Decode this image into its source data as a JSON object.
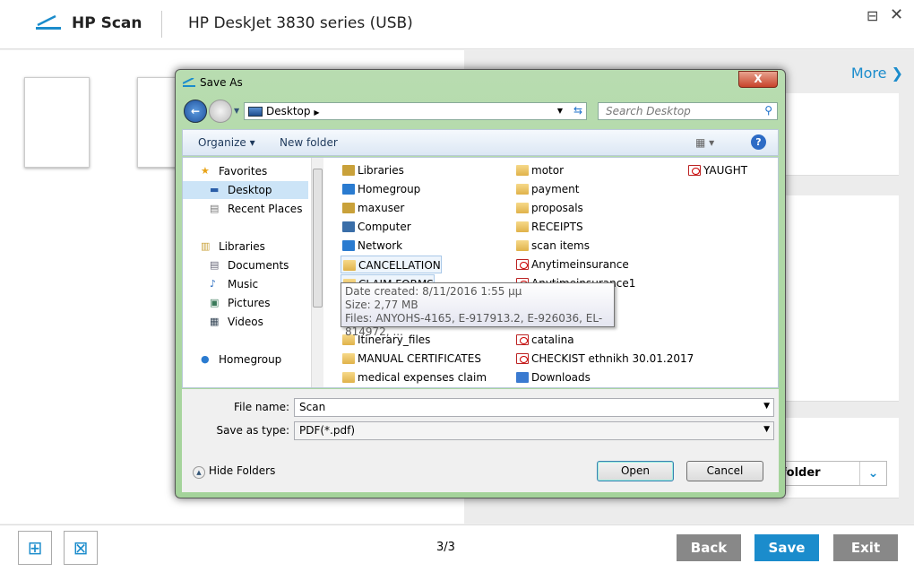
{
  "app": {
    "name": "HP Scan",
    "device": "HP DeskJet 3830 series (USB)",
    "minimize": "⊟",
    "close": "✕"
  },
  "right": {
    "more": "More",
    "destination": "folder",
    "colors": {
      "accent": "#1b8ccc"
    }
  },
  "footer": {
    "page": "3/3",
    "back": "Back",
    "save": "Save",
    "exit": "Exit",
    "add_page_icon": "add-page-icon",
    "delete_page_icon": "delete-page-icon"
  },
  "dialog": {
    "title": "Save As",
    "close": "X",
    "address": "Desktop",
    "search_placeholder": "Search Desktop",
    "toolbar": {
      "organize": "Organize ▾",
      "new_folder": "New folder"
    },
    "nav": [
      {
        "label": "Favorites",
        "head": true
      },
      {
        "label": "Desktop",
        "selected": true
      },
      {
        "label": "Recent Places"
      },
      {
        "label": "Libraries",
        "head": true
      },
      {
        "label": "Documents"
      },
      {
        "label": "Music"
      },
      {
        "label": "Pictures"
      },
      {
        "label": "Videos"
      },
      {
        "label": "Homegroup",
        "head": true
      }
    ],
    "files_col1": [
      "Libraries",
      "Homegroup",
      "maxuser",
      "Computer",
      "Network",
      "CANCELLATION",
      "CLAIM FORMS",
      "",
      "",
      "Itinerary_files",
      "MANUAL CERTIFICATES",
      "medical expenses claim"
    ],
    "files_col2": [
      "motor",
      "payment",
      "proposals",
      "RECEIPTS",
      "scan items",
      "Anytimeinsurance",
      "Anytimeinsurance1",
      "",
      "h",
      "catalina",
      "CHECKIST ethnikh 30.01.2017",
      "Downloads"
    ],
    "files_col3": [
      "YAUGHT"
    ],
    "tooltip": {
      "date": "Date created: 8/11/2016 1:55 μμ",
      "size": "Size: 2,77 MB",
      "files": "Files: ANYOHS-4165, E-917913.2, E-926036, EL-814972, ..."
    },
    "file_name_label": "File name:",
    "file_name": "Scan",
    "type_label": "Save as type:",
    "type": "PDF(*.pdf)",
    "hide_folders": "Hide Folders",
    "open": "Open",
    "cancel": "Cancel"
  }
}
